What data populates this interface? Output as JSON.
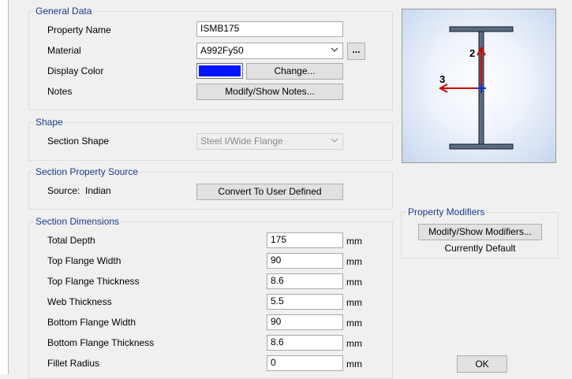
{
  "general": {
    "title": "General Data",
    "property_name_label": "Property Name",
    "property_name_value": "ISMB175",
    "material_label": "Material",
    "material_value": "A992Fy50",
    "material_more_label": "...",
    "display_color_label": "Display Color",
    "display_color_hex": "#0014ff",
    "change_label": "Change...",
    "notes_label": "Notes",
    "notes_button_label": "Modify/Show Notes..."
  },
  "shape": {
    "title": "Shape",
    "section_shape_label": "Section Shape",
    "section_shape_value": "Steel I/Wide Flange"
  },
  "source": {
    "title": "Section Property Source",
    "source_label": "Source:  Indian",
    "convert_label": "Convert To User Defined"
  },
  "dimensions": {
    "title": "Section Dimensions",
    "rows": [
      {
        "label": "Total Depth",
        "value": "175",
        "unit": "mm"
      },
      {
        "label": "Top Flange Width",
        "value": "90",
        "unit": "mm"
      },
      {
        "label": "Top Flange Thickness",
        "value": "8.6",
        "unit": "mm"
      },
      {
        "label": "Web Thickness",
        "value": "5.5",
        "unit": "mm"
      },
      {
        "label": "Bottom Flange Width",
        "value": "90",
        "unit": "mm"
      },
      {
        "label": "Bottom Flange Thickness",
        "value": "8.6",
        "unit": "mm"
      },
      {
        "label": "Fillet Radius",
        "value": "0",
        "unit": "mm"
      }
    ]
  },
  "preview": {
    "axis_2": "2",
    "axis_3": "3",
    "steel_color": "#5a6b85",
    "axis_color": "#d40000",
    "centroid_color": "#1b2fbf"
  },
  "modifiers": {
    "title": "Property Modifiers",
    "button_label": "Modify/Show Modifiers...",
    "status": "Currently Default"
  },
  "ok_label": "OK"
}
